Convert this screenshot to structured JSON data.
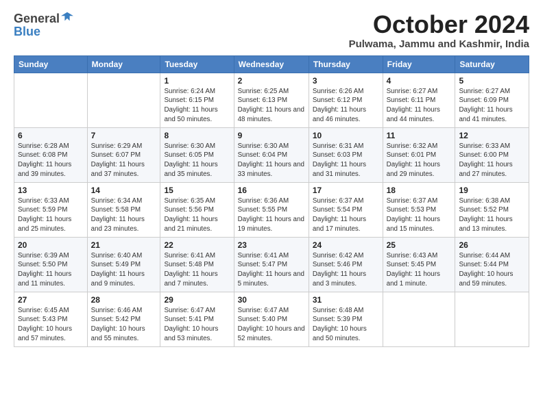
{
  "logo": {
    "general": "General",
    "blue": "Blue"
  },
  "title": "October 2024",
  "location": "Pulwama, Jammu and Kashmir, India",
  "days_of_week": [
    "Sunday",
    "Monday",
    "Tuesday",
    "Wednesday",
    "Thursday",
    "Friday",
    "Saturday"
  ],
  "weeks": [
    [
      {
        "day": "",
        "info": ""
      },
      {
        "day": "",
        "info": ""
      },
      {
        "day": "1",
        "info": "Sunrise: 6:24 AM\nSunset: 6:15 PM\nDaylight: 11 hours and 50 minutes."
      },
      {
        "day": "2",
        "info": "Sunrise: 6:25 AM\nSunset: 6:13 PM\nDaylight: 11 hours and 48 minutes."
      },
      {
        "day": "3",
        "info": "Sunrise: 6:26 AM\nSunset: 6:12 PM\nDaylight: 11 hours and 46 minutes."
      },
      {
        "day": "4",
        "info": "Sunrise: 6:27 AM\nSunset: 6:11 PM\nDaylight: 11 hours and 44 minutes."
      },
      {
        "day": "5",
        "info": "Sunrise: 6:27 AM\nSunset: 6:09 PM\nDaylight: 11 hours and 41 minutes."
      }
    ],
    [
      {
        "day": "6",
        "info": "Sunrise: 6:28 AM\nSunset: 6:08 PM\nDaylight: 11 hours and 39 minutes."
      },
      {
        "day": "7",
        "info": "Sunrise: 6:29 AM\nSunset: 6:07 PM\nDaylight: 11 hours and 37 minutes."
      },
      {
        "day": "8",
        "info": "Sunrise: 6:30 AM\nSunset: 6:05 PM\nDaylight: 11 hours and 35 minutes."
      },
      {
        "day": "9",
        "info": "Sunrise: 6:30 AM\nSunset: 6:04 PM\nDaylight: 11 hours and 33 minutes."
      },
      {
        "day": "10",
        "info": "Sunrise: 6:31 AM\nSunset: 6:03 PM\nDaylight: 11 hours and 31 minutes."
      },
      {
        "day": "11",
        "info": "Sunrise: 6:32 AM\nSunset: 6:01 PM\nDaylight: 11 hours and 29 minutes."
      },
      {
        "day": "12",
        "info": "Sunrise: 6:33 AM\nSunset: 6:00 PM\nDaylight: 11 hours and 27 minutes."
      }
    ],
    [
      {
        "day": "13",
        "info": "Sunrise: 6:33 AM\nSunset: 5:59 PM\nDaylight: 11 hours and 25 minutes."
      },
      {
        "day": "14",
        "info": "Sunrise: 6:34 AM\nSunset: 5:58 PM\nDaylight: 11 hours and 23 minutes."
      },
      {
        "day": "15",
        "info": "Sunrise: 6:35 AM\nSunset: 5:56 PM\nDaylight: 11 hours and 21 minutes."
      },
      {
        "day": "16",
        "info": "Sunrise: 6:36 AM\nSunset: 5:55 PM\nDaylight: 11 hours and 19 minutes."
      },
      {
        "day": "17",
        "info": "Sunrise: 6:37 AM\nSunset: 5:54 PM\nDaylight: 11 hours and 17 minutes."
      },
      {
        "day": "18",
        "info": "Sunrise: 6:37 AM\nSunset: 5:53 PM\nDaylight: 11 hours and 15 minutes."
      },
      {
        "day": "19",
        "info": "Sunrise: 6:38 AM\nSunset: 5:52 PM\nDaylight: 11 hours and 13 minutes."
      }
    ],
    [
      {
        "day": "20",
        "info": "Sunrise: 6:39 AM\nSunset: 5:50 PM\nDaylight: 11 hours and 11 minutes."
      },
      {
        "day": "21",
        "info": "Sunrise: 6:40 AM\nSunset: 5:49 PM\nDaylight: 11 hours and 9 minutes."
      },
      {
        "day": "22",
        "info": "Sunrise: 6:41 AM\nSunset: 5:48 PM\nDaylight: 11 hours and 7 minutes."
      },
      {
        "day": "23",
        "info": "Sunrise: 6:41 AM\nSunset: 5:47 PM\nDaylight: 11 hours and 5 minutes."
      },
      {
        "day": "24",
        "info": "Sunrise: 6:42 AM\nSunset: 5:46 PM\nDaylight: 11 hours and 3 minutes."
      },
      {
        "day": "25",
        "info": "Sunrise: 6:43 AM\nSunset: 5:45 PM\nDaylight: 11 hours and 1 minute."
      },
      {
        "day": "26",
        "info": "Sunrise: 6:44 AM\nSunset: 5:44 PM\nDaylight: 10 hours and 59 minutes."
      }
    ],
    [
      {
        "day": "27",
        "info": "Sunrise: 6:45 AM\nSunset: 5:43 PM\nDaylight: 10 hours and 57 minutes."
      },
      {
        "day": "28",
        "info": "Sunrise: 6:46 AM\nSunset: 5:42 PM\nDaylight: 10 hours and 55 minutes."
      },
      {
        "day": "29",
        "info": "Sunrise: 6:47 AM\nSunset: 5:41 PM\nDaylight: 10 hours and 53 minutes."
      },
      {
        "day": "30",
        "info": "Sunrise: 6:47 AM\nSunset: 5:40 PM\nDaylight: 10 hours and 52 minutes."
      },
      {
        "day": "31",
        "info": "Sunrise: 6:48 AM\nSunset: 5:39 PM\nDaylight: 10 hours and 50 minutes."
      },
      {
        "day": "",
        "info": ""
      },
      {
        "day": "",
        "info": ""
      }
    ]
  ]
}
